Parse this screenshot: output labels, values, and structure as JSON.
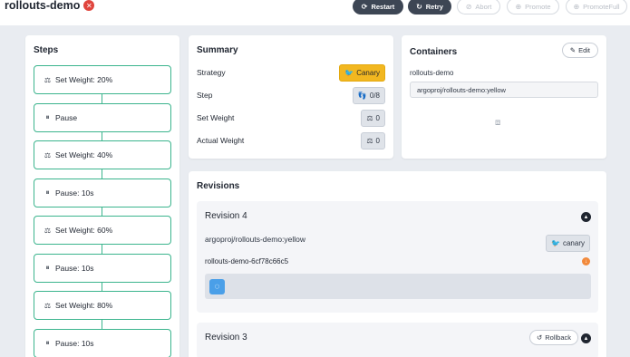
{
  "header": {
    "title": "rollouts-demo",
    "status_icon": "error-icon",
    "buttons": [
      {
        "label": "Restart",
        "icon": "restart-icon",
        "enabled": true
      },
      {
        "label": "Retry",
        "icon": "retry-icon",
        "enabled": true
      },
      {
        "label": "Abort",
        "icon": "abort-icon",
        "enabled": false
      },
      {
        "label": "Promote",
        "icon": "promote-icon",
        "enabled": false
      },
      {
        "label": "PromoteFull",
        "icon": "promote-full-icon",
        "enabled": false
      }
    ]
  },
  "steps": {
    "title": "Steps",
    "items": [
      {
        "label": "Set Weight: 20%",
        "icon": "weight-icon"
      },
      {
        "label": "Pause",
        "icon": "pause-icon"
      },
      {
        "label": "Set Weight: 40%",
        "icon": "weight-icon"
      },
      {
        "label": "Pause: 10s",
        "icon": "pause-icon"
      },
      {
        "label": "Set Weight: 60%",
        "icon": "weight-icon"
      },
      {
        "label": "Pause: 10s",
        "icon": "pause-icon"
      },
      {
        "label": "Set Weight: 80%",
        "icon": "weight-icon"
      },
      {
        "label": "Pause: 10s",
        "icon": "pause-icon"
      }
    ]
  },
  "summary": {
    "title": "Summary",
    "rows": [
      {
        "label": "Strategy",
        "value": "Canary",
        "icon": "canary-icon"
      },
      {
        "label": "Step",
        "value": "0/8",
        "icon": "shoe-prints-icon"
      },
      {
        "label": "Set Weight",
        "value": "0",
        "icon": "balance-scale-icon"
      },
      {
        "label": "Actual Weight",
        "value": "0",
        "icon": "balance-scale-icon"
      }
    ]
  },
  "containers": {
    "title": "Containers",
    "edit_label": "Edit",
    "name": "rollouts-demo",
    "image": "argoproj/rollouts-demo:yellow"
  },
  "revisions": {
    "title": "Revisions",
    "items": [
      {
        "title": "Revision 4",
        "image": "argoproj/rollouts-demo:yellow",
        "badge": "canary",
        "replicaset": "rollouts-demo-6cf78c66c5"
      },
      {
        "title": "Revision 3",
        "rollback_label": "Rollback"
      }
    ]
  },
  "colors": {
    "accent_green": "#3bb48d",
    "canary_yellow": "#f2b720",
    "error_red": "#e0453d",
    "pod_blue": "#4a9fe8",
    "button_dark": "#3d4654"
  }
}
